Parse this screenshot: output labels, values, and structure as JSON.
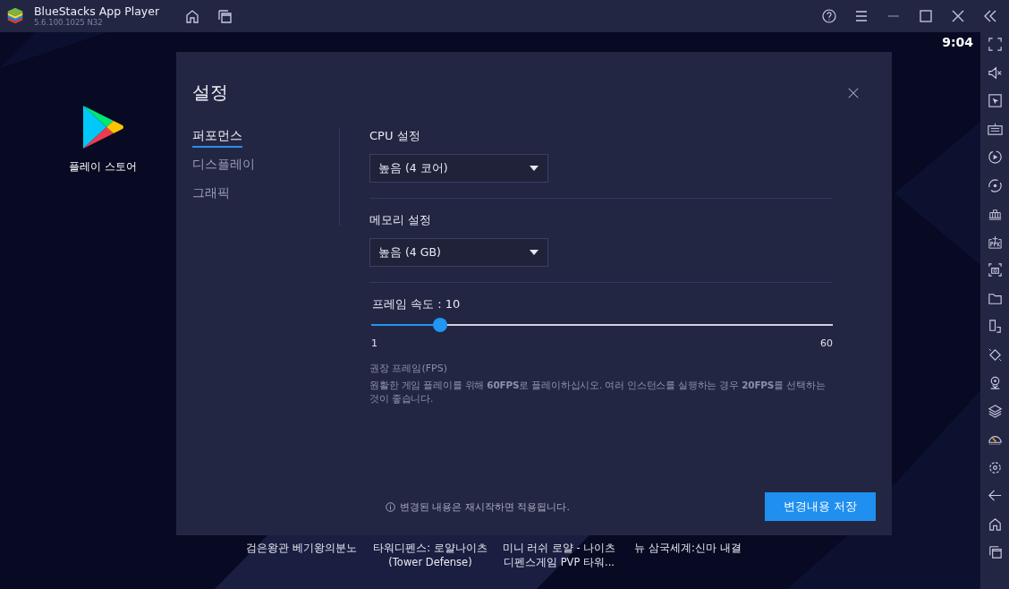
{
  "window": {
    "title": "BlueStacks App Player",
    "version": "5.6.100.1025  N32"
  },
  "status_bar": {
    "time": "9:04"
  },
  "home_apps": [
    {
      "label": "플레이 스토어"
    }
  ],
  "background_apps": [
    {
      "lines": [
        "검은왕관 베기왕의분노"
      ]
    },
    {
      "lines": [
        "타워디펜스: 로얄나이츠",
        "(Tower Defense)"
      ]
    },
    {
      "lines": [
        "미니 러쉬 로얄 - 나이츠",
        "디펜스게임 PVP 타워..."
      ]
    },
    {
      "lines": [
        "뉴 삼국세계:신마 내결"
      ]
    }
  ],
  "dialog": {
    "title": "설정",
    "nav": [
      {
        "label": "퍼포먼스",
        "selected": true
      },
      {
        "label": "디스플레이",
        "selected": false
      },
      {
        "label": "그래픽",
        "selected": false
      }
    ],
    "settings": [
      {
        "kind": "dropdown",
        "label": "CPU 설정",
        "value": "높음 (4 코어)"
      },
      {
        "kind": "dropdown",
        "label": "메모리 설정",
        "value": "높음 (4 GB)"
      },
      {
        "kind": "slider",
        "label": "프레임 속도 : 10",
        "level": 0.15,
        "min_label": "1",
        "max_label": "60"
      }
    ],
    "hint_title": "권장 프레임(FPS)",
    "hint_text": "원활한 게임 플레이를 위해 **60FPS**로 플레이하십시오. 여러 인스턴스를 실행하는 경우 **20FPS**를 선택하는 것이 좋습니다.",
    "footer_note": "변경된 내용은 재시작하면 적용됩니다.",
    "save_button": "변경내용 저장"
  }
}
